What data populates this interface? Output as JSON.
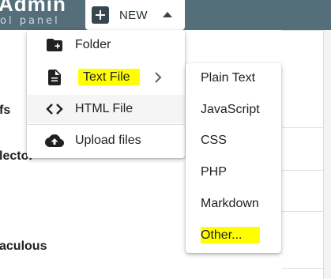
{
  "header": {
    "brand_title": "Admin",
    "brand_subtitle": "ol panel",
    "new_button_label": "NEW"
  },
  "background": {
    "fragments": [
      "fs",
      "lector",
      "aculous"
    ]
  },
  "new_menu": {
    "items": [
      {
        "label": "Folder",
        "icon": "folder-plus-icon"
      },
      {
        "label": "Text File",
        "icon": "text-file-icon",
        "highlighted": true,
        "has_submenu": true
      },
      {
        "label": "HTML File",
        "icon": "code-icon"
      },
      {
        "label": "Upload files",
        "icon": "cloud-upload-icon"
      }
    ]
  },
  "submenu": {
    "items": [
      {
        "label": "Plain Text"
      },
      {
        "label": "JavaScript"
      },
      {
        "label": "CSS"
      },
      {
        "label": "PHP"
      },
      {
        "label": "Markdown"
      },
      {
        "label": "Other...",
        "highlighted": true
      }
    ]
  },
  "colors": {
    "header_bg": "#546e7a",
    "highlight": "#ffff00",
    "icon_dark": "#212121"
  }
}
